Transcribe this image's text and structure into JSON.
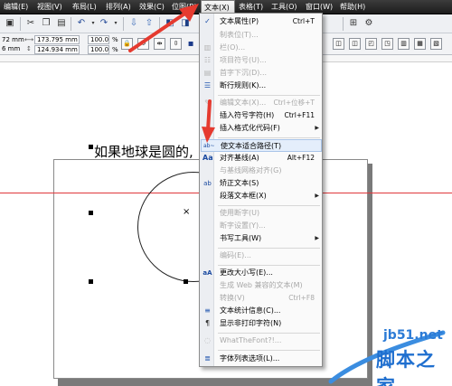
{
  "menubar": {
    "items": [
      {
        "label": "编辑(E)"
      },
      {
        "label": "视图(V)"
      },
      {
        "label": "布局(L)"
      },
      {
        "label": "排列(A)"
      },
      {
        "label": "效果(C)"
      },
      {
        "label": "位图(B)"
      },
      {
        "label": "文本(X)"
      },
      {
        "label": "表格(T)"
      },
      {
        "label": "工具(O)"
      },
      {
        "label": "窗口(W)"
      },
      {
        "label": "帮助(H)"
      }
    ]
  },
  "property_bar": {
    "width_partial": "72 mm",
    "height_partial": "6 mm",
    "x_value": "173.795 mm",
    "y_value": "124.934 mm",
    "scale_x": "100.0",
    "scale_y": "100.0",
    "percent": "%"
  },
  "canvas": {
    "sample_text": "如果地球是圆的,"
  },
  "text_menu": {
    "items": [
      {
        "label": "文本属性(P)",
        "shortcut": "Ctrl+T",
        "icon": "checkmark-icon"
      },
      {
        "label": "制表位(T)...",
        "disabled": true
      },
      {
        "label": "栏(O)...",
        "disabled": true
      },
      {
        "label": "项目符号(U)...",
        "disabled": true
      },
      {
        "label": "首字下沉(D)...",
        "disabled": true
      },
      {
        "label": "断行规则(K)...",
        "icon": "line-break-icon"
      },
      {
        "label": "编辑文本(X)...",
        "shortcut": "Ctrl+位移+T",
        "disabled": true
      },
      {
        "label": "插入符号字符(H)",
        "shortcut": "Ctrl+F11"
      },
      {
        "label": "插入格式化代码(F)",
        "submenu": true
      },
      {
        "label": "使文本适合路径(T)",
        "icon": "fit-text-path-icon"
      },
      {
        "label": "对齐基线(A)",
        "shortcut": "Alt+F12",
        "icon": "align-baseline-icon"
      },
      {
        "label": "与基线网格对齐(G)",
        "disabled": true
      },
      {
        "label": "矫正文本(S)",
        "icon": "straighten-text-icon"
      },
      {
        "label": "段落文本框(X)",
        "submenu": true
      },
      {
        "label": "使用断字(U)",
        "disabled": true
      },
      {
        "label": "断字设置(Y)...",
        "disabled": true
      },
      {
        "label": "书写工具(W)",
        "submenu": true
      },
      {
        "label": "编码(E)...",
        "disabled": true
      },
      {
        "label": "更改大小写(E)...",
        "icon": "change-case-icon"
      },
      {
        "label": "生成 Web 兼容的文本(M)",
        "disabled": true
      },
      {
        "label": "转换(V)",
        "shortcut": "Ctrl+F8",
        "disabled": true
      },
      {
        "label": "文本统计信息(C)...",
        "icon": "text-stats-icon"
      },
      {
        "label": "显示非打印字符(N)",
        "icon": "pilcrow-icon"
      },
      {
        "label": "WhatTheFont?!...",
        "disabled": true
      },
      {
        "label": "字体列表选项(L)...",
        "icon": "font-list-icon"
      }
    ],
    "icons": {
      "fit-text-path-icon": "ab~",
      "align-baseline-icon": "Aa",
      "straighten-text-icon": "ab",
      "change-case-icon": "aA",
      "text-stats-icon": "≡",
      "pilcrow-icon": "¶",
      "font-list-icon": "≣",
      "line-break-icon": "☰",
      "checkmark-icon": "✓"
    }
  },
  "watermark": {
    "site": "jb51.net",
    "name": "脚本之家"
  },
  "colors": {
    "guide": "#e0383c",
    "arrow": "#e53a2f",
    "menu_highlight": "#e4eefb",
    "watermark": "#1f6fcf"
  }
}
